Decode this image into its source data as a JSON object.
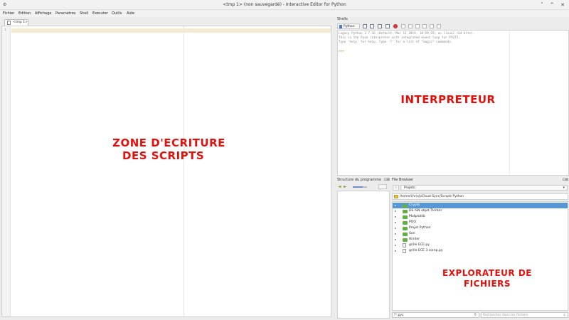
{
  "window": {
    "title": "<tmp 1> (non sauvegardé) - Interactive Editor for Python",
    "app_icon": "python-app-icon",
    "controls": [
      "˅",
      "^",
      "✕"
    ]
  },
  "menu": [
    "Fichier",
    "Edition",
    "Affichage",
    "Paramètres",
    "Shell",
    "Exécuter",
    "Outils",
    "Aide"
  ],
  "editor": {
    "tab_label": "<tmp 1>",
    "line_numbers": [
      "1"
    ],
    "annotation_line1": "ZONE D'ECRITURE",
    "annotation_line2": "DES SCRIPTS"
  },
  "shells": {
    "header": "Shells",
    "interpreter_button": "Python",
    "banner": [
      "Legacy Python 2.7.16 (default, Mar 11 2019, 18:59:25) on linux2 (64 bits).",
      "This is the Pyzo interpreter with integrated event loop for PYQT5.",
      "Type 'help' for help, type '?' for a list of *magic* commands."
    ],
    "prompt": ">>>",
    "annotation": "INTERPRETEUR"
  },
  "structure": {
    "header": "Structure du programme",
    "header_controls": "⊡⊠",
    "slider_level": 0.7
  },
  "file_browser": {
    "header": "File Browser",
    "header_controls": "⊡⊠",
    "star": "☆",
    "project_select": "Projets:",
    "path": "/home/chris/pCloud Sync/Scripts Python",
    "items": [
      {
        "name": "Crypto",
        "type": "folder",
        "selected": true
      },
      {
        "name": "DS ISN objet Tkinter",
        "type": "folder",
        "selected": false
      },
      {
        "name": "Matplotlib",
        "type": "folder",
        "selected": false
      },
      {
        "name": "POO",
        "type": "folder",
        "selected": false
      },
      {
        "name": "Projet Python",
        "type": "folder",
        "selected": false
      },
      {
        "name": "Son",
        "type": "folder",
        "selected": false
      },
      {
        "name": "tkinter",
        "type": "folder",
        "selected": false
      },
      {
        "name": "grille ECE.py",
        "type": "file",
        "selected": false
      },
      {
        "name": "grille ECE 3 comp.py",
        "type": "file",
        "selected": false
      }
    ],
    "filter_value": "!*.pyc",
    "search_placeholder": "Rechercher dans les fichiers",
    "annotation_line1": "EXPLORATEUR DE",
    "annotation_line2": "FICHIERS"
  },
  "colors": {
    "annotation": "#e3100c",
    "selection": "#5797d6",
    "folder": "#62b041",
    "current_line": "#f3ebd4",
    "prompt": "#8fb03f"
  }
}
